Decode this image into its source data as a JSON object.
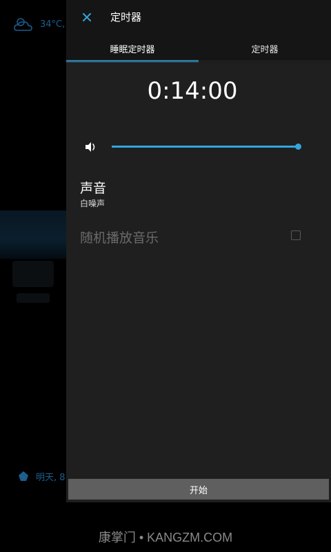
{
  "background": {
    "weather_text": "34°C,",
    "alarm_text": "明天, 8:"
  },
  "header": {
    "close_icon": "close-icon",
    "title": "定时器"
  },
  "tabs": [
    {
      "label": "睡眠定时器",
      "active": true
    },
    {
      "label": "定时器",
      "active": false
    }
  ],
  "timer": {
    "time": "0:14:00"
  },
  "volume": {
    "icon": "volume-icon",
    "level": 1.0
  },
  "sound": {
    "title": "声音",
    "value": "白噪声"
  },
  "shuffle": {
    "label": "随机播放音乐",
    "checked": false
  },
  "start_button": {
    "label": "开始"
  },
  "watermark": "康掌门 • KANGZM.COM",
  "colors": {
    "accent": "#33a6de",
    "panel": "#1f1f1f",
    "header": "#151515",
    "button": "#5f5f5f"
  }
}
